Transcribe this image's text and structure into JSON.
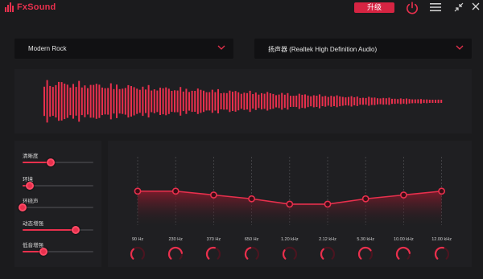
{
  "app": {
    "name": "FxSound"
  },
  "topbar": {
    "upgrade_label": "升级"
  },
  "preset": {
    "label": "Modern Rock"
  },
  "device": {
    "label": "扬声器 (Realtek High Definition Audio)"
  },
  "effects": [
    {
      "label": "清晰度",
      "level": 0.4
    },
    {
      "label": "环境",
      "level": 0.1
    },
    {
      "label": "环绕声",
      "level": 0.0
    },
    {
      "label": "动态增强",
      "level": 0.75
    },
    {
      "label": "低音增强",
      "level": 0.3
    }
  ],
  "eq": {
    "bands": [
      {
        "freq": "90 Hz",
        "level": 0.55
      },
      {
        "freq": "230 Hz",
        "level": 0.55
      },
      {
        "freq": "370 Hz",
        "level": 0.5
      },
      {
        "freq": "650 Hz",
        "level": 0.45
      },
      {
        "freq": "1.20 kHz",
        "level": 0.38
      },
      {
        "freq": "2.12 kHz",
        "level": 0.38
      },
      {
        "freq": "5.30 kHz",
        "level": 0.45
      },
      {
        "freq": "10.00 kHz",
        "level": 0.5
      },
      {
        "freq": "12.00 kHz",
        "level": 0.55
      }
    ]
  },
  "colors": {
    "accent": "#e8304d",
    "background": "#1b1b1d",
    "panel": "#1f1f22"
  }
}
